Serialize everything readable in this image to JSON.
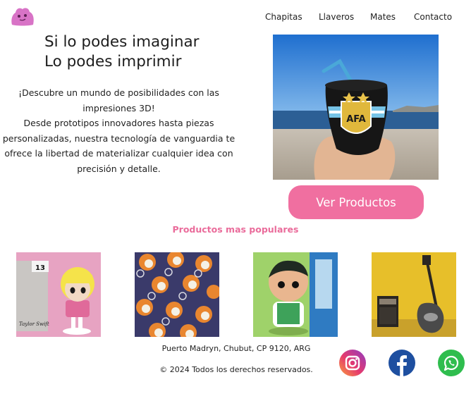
{
  "nav": {
    "items": [
      {
        "label": "Chapitas"
      },
      {
        "label": "Llaveros"
      },
      {
        "label": "Mates"
      },
      {
        "label": "Contacto"
      }
    ]
  },
  "hero": {
    "title_line1": "Si lo podes imaginar",
    "title_line2": "Lo podes imprimir",
    "desc_line1": "¡Descubre un mundo de posibilidades con las",
    "desc_line2": "impresiones 3D!",
    "desc_line3": "Desde prototipos innovadores hasta piezas",
    "desc_line4": "personalizadas, nuestra tecnología de vanguardia te",
    "desc_line5": "ofrece la libertad de materializar cualquier idea con",
    "desc_line6": "precisión y detalle.",
    "mate_text": "AFA",
    "cta_label": "Ver Productos"
  },
  "popular": {
    "title": "Productos mas populares",
    "tag_number": "13",
    "signature": "Taylor Swift"
  },
  "footer": {
    "address": "Puerto Madryn, Chubut, CP 9120, ARG",
    "copyright": "© 2024 Todos los derechos reservados."
  },
  "colors": {
    "accent": "#f06fa0",
    "section_title": "#ea6c9b",
    "logo": "#d873c6"
  },
  "icons": {
    "logo": "pink-blob-logo",
    "instagram": "instagram-icon",
    "facebook": "facebook-icon",
    "whatsapp": "whatsapp-icon"
  }
}
